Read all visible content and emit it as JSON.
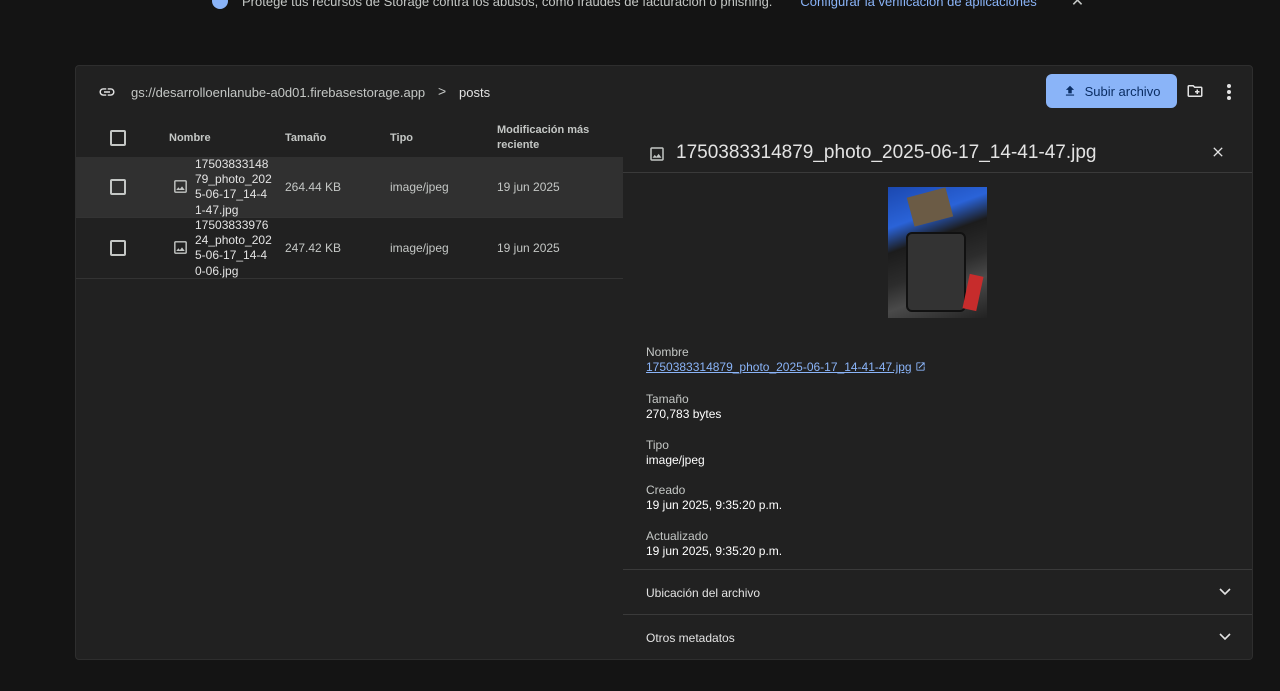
{
  "banner": {
    "text": "Protege tus recursos de Storage contra los abusos, como fraudes de facturación o phishing.",
    "link": "Configurar la verificación de aplicaciones"
  },
  "toolbar": {
    "bucket": "gs://desarrolloenlanube-a0d01.firebasestorage.app",
    "separator": ">",
    "folder": "posts",
    "upload_label": "Subir archivo"
  },
  "table": {
    "headers": {
      "name": "Nombre",
      "size": "Tamaño",
      "type": "Tipo",
      "modified": "Modificación más reciente"
    },
    "rows": [
      {
        "name": "1750383314879_photo_2025-06-17_14-41-47.jpg",
        "size": "264.44 KB",
        "type": "image/jpeg",
        "modified": "19 jun 2025",
        "selected": true
      },
      {
        "name": "1750383397624_photo_2025-06-17_14-40-06.jpg",
        "size": "247.42 KB",
        "type": "image/jpeg",
        "modified": "19 jun 2025",
        "selected": false
      }
    ]
  },
  "details": {
    "title": "1750383314879_photo_2025-06-17_14-41-47.jpg",
    "fields": {
      "name_label": "Nombre",
      "name_value": "1750383314879_photo_2025-06-17_14-41-47.jpg",
      "size_label": "Tamaño",
      "size_value": "270,783 bytes",
      "type_label": "Tipo",
      "type_value": "image/jpeg",
      "created_label": "Creado",
      "created_value": "19 jun 2025, 9:35:20 p.m.",
      "updated_label": "Actualizado",
      "updated_value": "19 jun 2025, 9:35:20 p.m."
    },
    "sections": {
      "location": "Ubicación del archivo",
      "other_metadata": "Otros metadatos"
    }
  },
  "colors": {
    "accent": "#8ab4f8",
    "background": "#141414",
    "card": "#212121",
    "selected_row": "#303030"
  }
}
